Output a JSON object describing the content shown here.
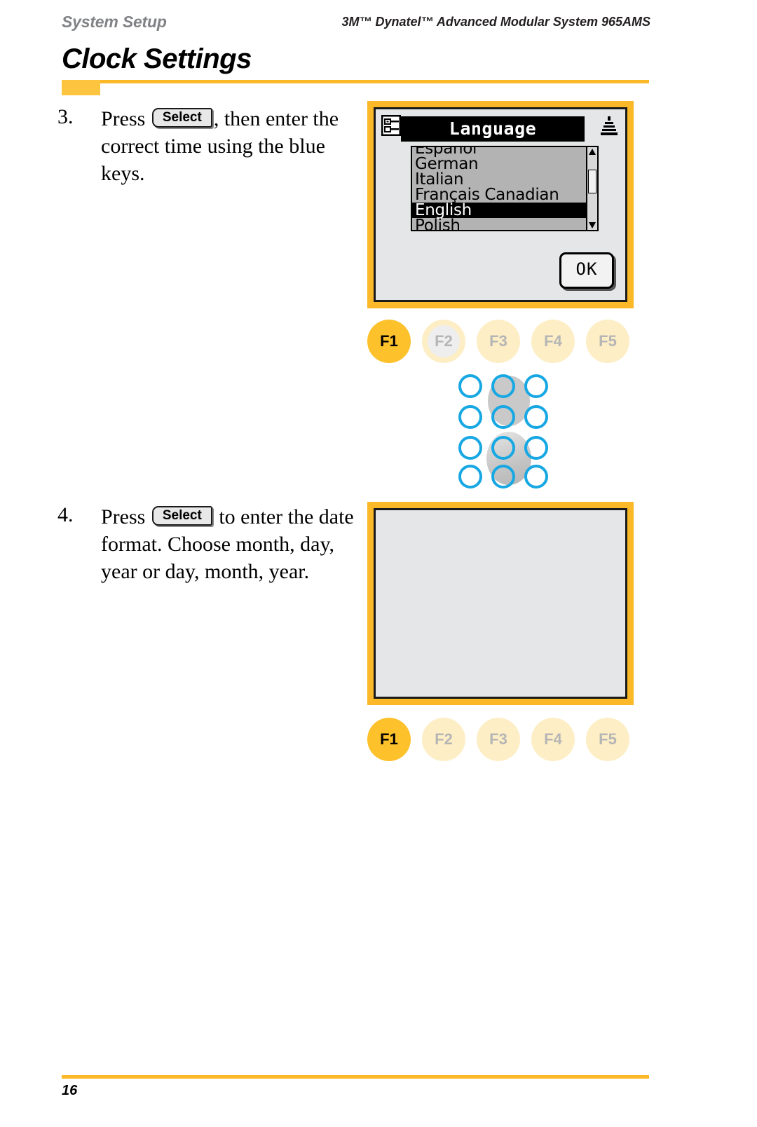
{
  "header": {
    "section": "System Setup",
    "product": "3M™ Dynatel™ Advanced Modular System 965AMS"
  },
  "title": "Clock Settings",
  "steps": [
    {
      "number": "3.",
      "text_before": "Press",
      "key_label": "Select",
      "text_after": ", then enter the correct time using the blue keys."
    },
    {
      "number": "4.",
      "text_before": "Press",
      "key_label": "Select",
      "text_after": " to enter the date format. Choose month, day, year or day, month, year."
    }
  ],
  "screen1": {
    "icon_left": "list-options-icon",
    "icon_right": "signal-strength-icon",
    "title": "Language",
    "list": [
      {
        "label": "Español",
        "selected": false
      },
      {
        "label": "German",
        "selected": false
      },
      {
        "label": "Italian",
        "selected": false
      },
      {
        "label": "Français Canadian",
        "selected": false
      },
      {
        "label": "English",
        "selected": true
      },
      {
        "label": "Polish",
        "selected": false
      }
    ],
    "ok_label": "OK"
  },
  "screen2": {
    "content": ""
  },
  "fkeys_row1": [
    {
      "label": "F1",
      "state": "active"
    },
    {
      "label": "F2",
      "state": "dim"
    },
    {
      "label": "F3",
      "state": "idle"
    },
    {
      "label": "F4",
      "state": "idle"
    },
    {
      "label": "F5",
      "state": "idle"
    }
  ],
  "fkeys_row2": [
    {
      "label": "F1",
      "state": "active"
    },
    {
      "label": "F2",
      "state": "idle"
    },
    {
      "label": "F3",
      "state": "idle"
    },
    {
      "label": "F4",
      "state": "idle"
    },
    {
      "label": "F5",
      "state": "idle"
    }
  ],
  "keypad": {
    "rows": 4,
    "cols": 3,
    "key_color": "#17a8e3"
  },
  "footer": {
    "page_number": "16"
  },
  "colors": {
    "accent_yellow": "#fbb829",
    "tab_yellow": "#fdc53f",
    "fkey_active": "#fcc12b",
    "fkey_idle": "#fdeec5",
    "blue_key": "#17a8e3",
    "lcd_background": "#e4e6e7",
    "list_background": "#b3b3b3"
  }
}
